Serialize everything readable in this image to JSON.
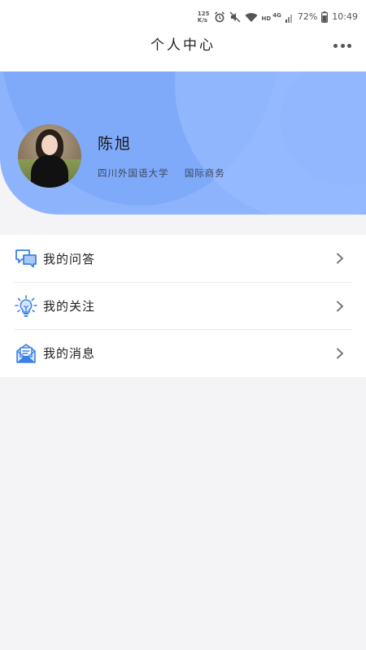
{
  "status_bar": {
    "network_top": "125",
    "network_bottom": "K/s",
    "hd_label": "HD",
    "lte_label": "4G",
    "battery_percent": "72%",
    "time": "10:49"
  },
  "nav": {
    "title": "个人中心"
  },
  "profile": {
    "name": "陈旭",
    "school": "四川外国语大学",
    "major": "国际商务"
  },
  "menu": {
    "items": [
      {
        "label": "我的问答",
        "icon": "chat-bubbles-icon"
      },
      {
        "label": "我的关注",
        "icon": "lightbulb-icon"
      },
      {
        "label": "我的消息",
        "icon": "envelope-icon"
      }
    ]
  },
  "colors": {
    "banner": "#8db3fd",
    "icon_blue": "#3c82e4",
    "background": "#f4f3f6"
  }
}
